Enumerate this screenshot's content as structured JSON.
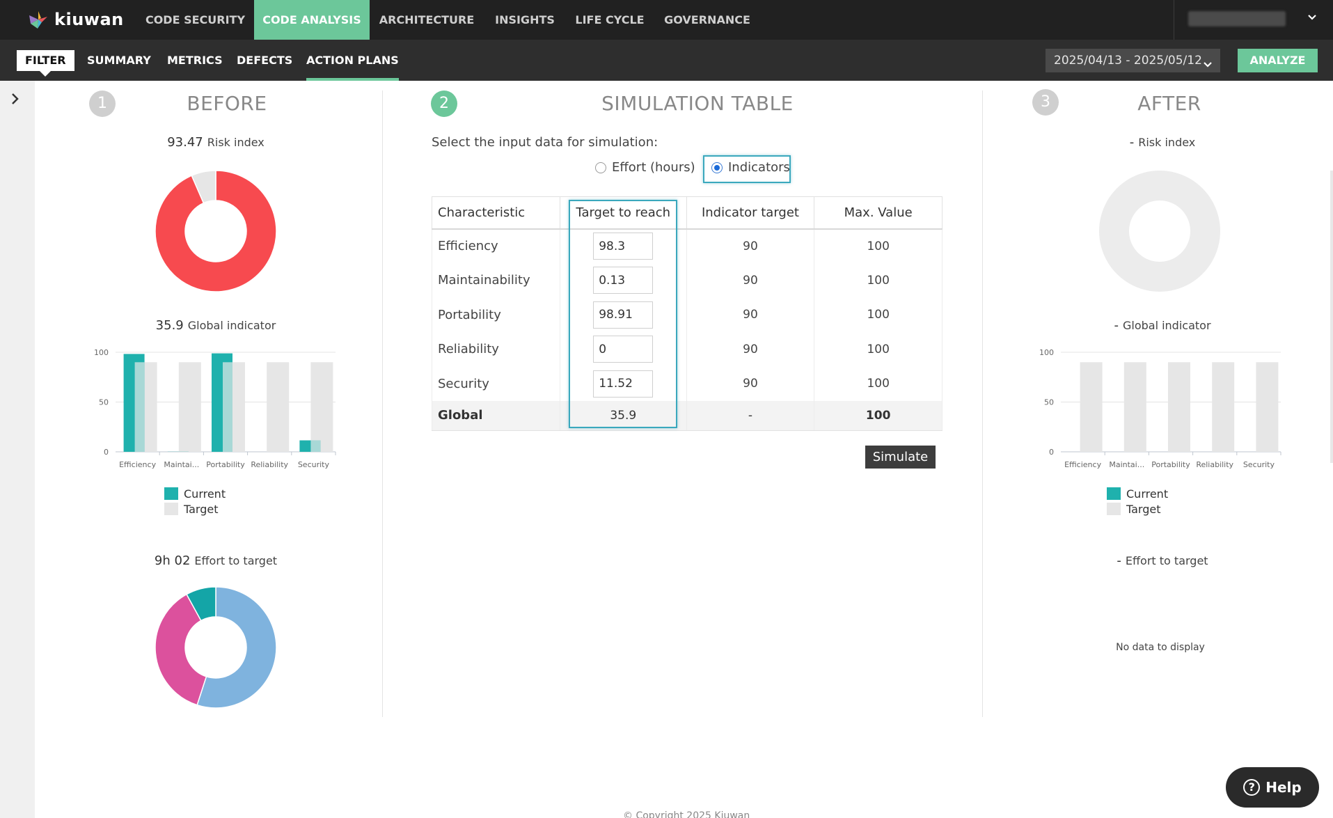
{
  "app": {
    "logo_text": "kiuwan"
  },
  "topnav": [
    {
      "label": "CODE SECURITY"
    },
    {
      "label": "CODE ANALYSIS",
      "active": true
    },
    {
      "label": "ARCHITECTURE"
    },
    {
      "label": "INSIGHTS"
    },
    {
      "label": "LIFE CYCLE"
    },
    {
      "label": "GOVERNANCE"
    }
  ],
  "subnav": {
    "filter": "FILTER",
    "items": [
      {
        "label": "SUMMARY"
      },
      {
        "label": "METRICS"
      },
      {
        "label": "DEFECTS"
      },
      {
        "label": "ACTION PLANS",
        "active": true
      }
    ],
    "date_range": "2025/04/13 - 2025/05/12",
    "analyze": "ANALYZE"
  },
  "colors": {
    "accent": "#6cc79a",
    "risk_red": "#f74a4f",
    "current_teal": "#1fb1ad",
    "target_gray": "#e6e6e6",
    "effort_blue": "#7fb3de",
    "effort_pink": "#dc519d",
    "effort_teal": "#14a5a7"
  },
  "before": {
    "step": "1",
    "title": "BEFORE",
    "risk_value": "93.47",
    "risk_label": "Risk index",
    "global_value": "35.9",
    "global_label": "Global indicator",
    "effort_value": "9h 02",
    "effort_label": "Effort to target",
    "legend_current": "Current",
    "legend_target": "Target"
  },
  "simulation": {
    "step": "2",
    "title": "SIMULATION TABLE",
    "prompt": "Select the input data for simulation:",
    "option_effort": "Effort (hours)",
    "option_indicators": "Indicators",
    "selected": "Indicators",
    "headers": [
      "Characteristic",
      "Target to reach",
      "Indicator target",
      "Max. Value"
    ],
    "rows": [
      {
        "name": "Efficiency",
        "target": "98.3",
        "indicator": "90",
        "max": "100"
      },
      {
        "name": "Maintainability",
        "target": "0.13",
        "indicator": "90",
        "max": "100"
      },
      {
        "name": "Portability",
        "target": "98.91",
        "indicator": "90",
        "max": "100"
      },
      {
        "name": "Reliability",
        "target": "0",
        "indicator": "90",
        "max": "100"
      },
      {
        "name": "Security",
        "target": "11.52",
        "indicator": "90",
        "max": "100"
      }
    ],
    "global": {
      "name": "Global",
      "target": "35.9",
      "indicator": "-",
      "max": "100"
    },
    "simulate": "Simulate"
  },
  "after": {
    "step": "3",
    "title": "AFTER",
    "risk_value": "-",
    "risk_label": "Risk index",
    "global_value": "-",
    "global_label": "Global indicator",
    "effort_value": "-",
    "effort_label": "Effort to target",
    "legend_current": "Current",
    "legend_target": "Target",
    "no_data": "No data to display"
  },
  "help": "Help",
  "footer": {
    "copyright": "© Copyright 2025 Kiuwan"
  },
  "chart_data": [
    {
      "type": "pie",
      "name": "before-risk-donut",
      "values": [
        93.47,
        6.53
      ],
      "colors": [
        "#f74a4f",
        "#e6e6e6"
      ]
    },
    {
      "type": "bar",
      "name": "before-global-bars",
      "categories": [
        "Efficiency",
        "Maintai...",
        "Portability",
        "Reliability",
        "Security"
      ],
      "ylim": [
        0,
        100
      ],
      "ticks": [
        "0",
        "50",
        "100"
      ],
      "series": [
        {
          "name": "Current",
          "values": [
            98.3,
            0.13,
            98.91,
            0,
            11.52
          ]
        },
        {
          "name": "Target",
          "values": [
            90,
            90,
            90,
            90,
            90
          ]
        }
      ]
    },
    {
      "type": "pie",
      "name": "before-effort-donut",
      "values": [
        55,
        37,
        8
      ],
      "colors": [
        "#7fb3de",
        "#dc519d",
        "#14a5a7"
      ]
    },
    {
      "type": "pie",
      "name": "after-risk-donut",
      "values": [
        100
      ],
      "colors": [
        "#ececec"
      ]
    },
    {
      "type": "bar",
      "name": "after-global-bars",
      "categories": [
        "Efficiency",
        "Maintai...",
        "Portability",
        "Reliability",
        "Security"
      ],
      "ylim": [
        0,
        100
      ],
      "ticks": [
        "0",
        "50",
        "100"
      ],
      "series": [
        {
          "name": "Current",
          "values": [
            0,
            0,
            0,
            0,
            0
          ]
        },
        {
          "name": "Target",
          "values": [
            90,
            90,
            90,
            90,
            90
          ]
        }
      ]
    }
  ]
}
